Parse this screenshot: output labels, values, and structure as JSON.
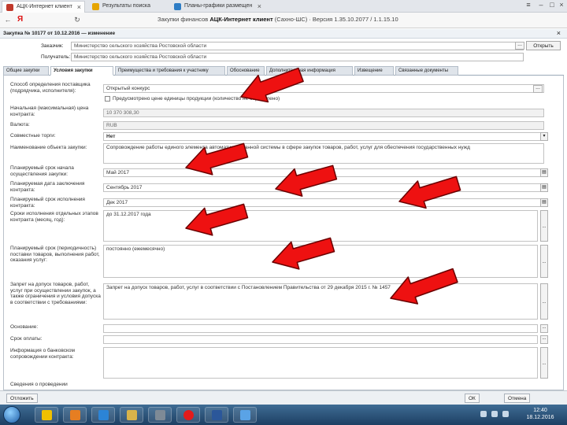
{
  "browser": {
    "tabs": [
      {
        "label": "АЦК-Интернет клиент"
      },
      {
        "label": "Результаты поиска"
      },
      {
        "label": "Планы-графики размещен"
      }
    ],
    "address_prefix": "Закупки финансов",
    "address_title": "АЦК-Интернет клиент",
    "address_suffix": "(Сахно-ШС) · Версия 1.35.10.2077 / 1.1.15.10",
    "logo": "Я"
  },
  "document": {
    "title": "Закупка № 10177 от 10.12.2016 — изменение",
    "fields": {
      "zakazchik_label": "Заказчик:",
      "zakazchik_value": "Министерство сельского хозяйства Ростовской области",
      "poluchatel_label": "Получатель:",
      "poluchatel_value": "Министерство сельского хозяйства Ростовской области"
    },
    "open_button": "Открыть"
  },
  "form_tabs": [
    {
      "label": "Общие закупки"
    },
    {
      "label": "Условия закупки"
    },
    {
      "label": "Преимущества и требования к участнику"
    },
    {
      "label": "Обоснование"
    },
    {
      "label": "Дополнительная информация"
    },
    {
      "label": "Извещение"
    },
    {
      "label": "Связанные документы"
    }
  ],
  "form": {
    "method_label": "Способ определения поставщика (подрядчика, исполнителя):",
    "method_value": "Открытый конкурс",
    "checkbox_label": "Предусмотрено цене единицы продукции (количество не определено)",
    "nmck_label": "Начальная (максимальная) цена контракта:",
    "nmck_value": "10 370 308,30",
    "currency_label": "Валюта:",
    "currency_value": "RUB",
    "tender_label": "Совместные торги:",
    "tender_value": "Нет",
    "subject_label": "Наименование объекта закупки:",
    "subject_value": "Сопровождение работы единого элемента автоматизированной системы в сфере закупок товаров, работ, услуг для обеспечения государственных нужд",
    "plan_start_label": "Планируемый срок начала осуществления закупки:",
    "plan_start_value": "Май 2017",
    "plan_contract_label": "Планируемая дата заключения контракта:",
    "plan_contract_value": "Сентябрь 2017",
    "plan_end_label": "Планируемый срок исполнения контракта:",
    "plan_end_value": "Дек 2017",
    "stages_label": "Сроки исполнения отдельных этапов контракта (месяц, год):",
    "stages_value": "до 31.12.2017 года",
    "periodicity_label": "Планируемый срок (периодичность) поставки товаров, выполнения работ, оказания услуг:",
    "periodicity_value": "постоянно (ежемесячно)",
    "restrictions_label": "Запрет на допуск товаров, работ, услуг при осуществлении закупок, а также ограничения и условия допуска в соответствии с требованиями:",
    "restrictions_value": "Запрет на допуск товаров, работ, услуг в соответствии с Постановлением Правительства от 29 декабря 2015 г. № 1457",
    "basis_label": "Основание:",
    "terms_label": "Срок оплаты:",
    "info_label": "Информация о банковском сопровождении контракта:",
    "public_label": "Сведения о проведении"
  },
  "statusbar": {
    "buttons": [
      "Отложить",
      "ОК",
      "Отмена"
    ]
  },
  "taskbar": {
    "time": "12:40",
    "date": "18.12.2016"
  },
  "colors": {
    "arrow": "#ee1111",
    "arrow_outline": "#6a0000"
  }
}
